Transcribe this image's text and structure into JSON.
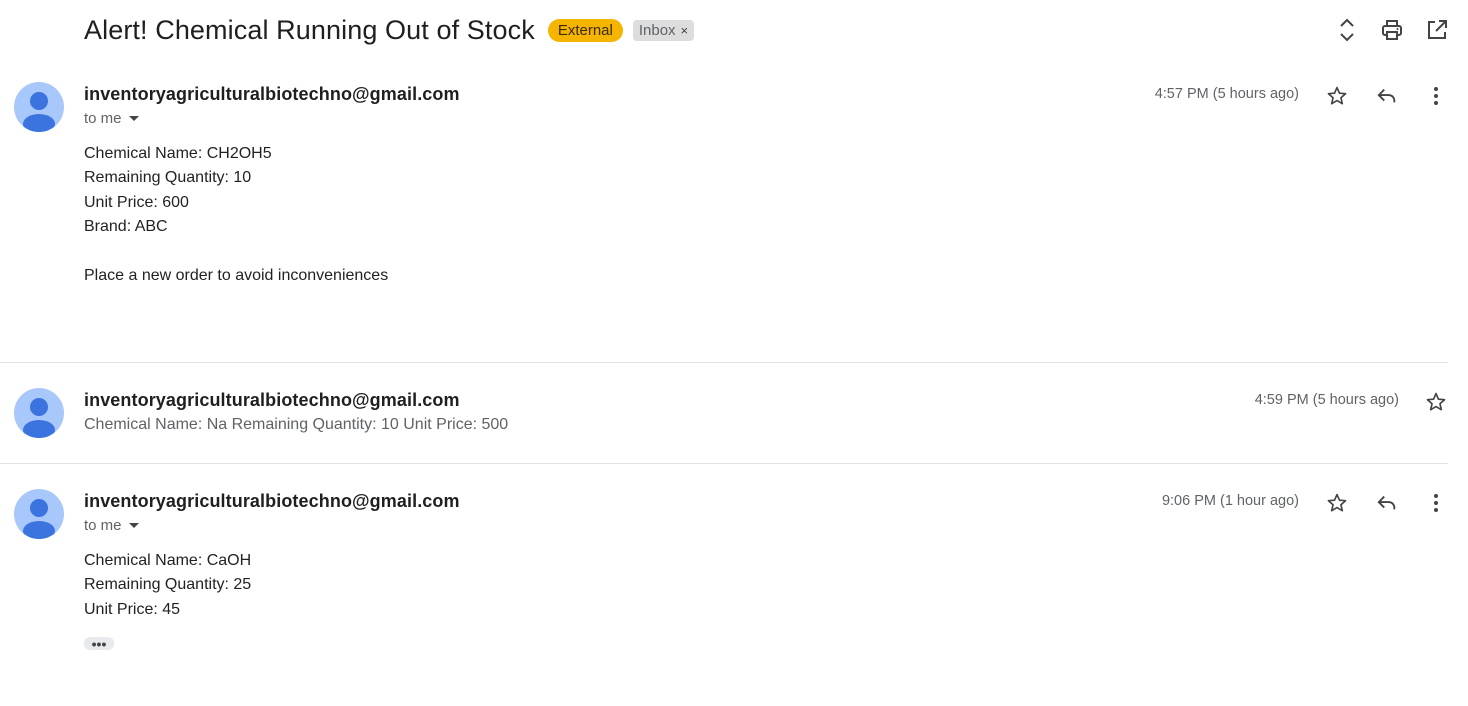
{
  "subject": "Alert! Chemical Running Out of Stock",
  "labels": {
    "external": "External",
    "inbox": "Inbox",
    "remove": "×"
  },
  "header_icons": [
    "expand-collapse-icon",
    "print-icon",
    "open-in-new-window-icon"
  ],
  "messages": [
    {
      "sender": "inventoryagriculturalbiotechno@gmail.com",
      "recipient": "to me",
      "time": "4:57 PM (5 hours ago)",
      "body": [
        "Chemical Name: CH2OH5",
        "Remaining Quantity: 10",
        "Unit Price: 600",
        "Brand: ABC",
        "Place a new order to avoid inconveniences"
      ]
    },
    {
      "sender": "inventoryagriculturalbiotechno@gmail.com",
      "time": "4:59 PM (5 hours ago)",
      "snippet": "Chemical Name: Na Remaining Quantity: 10 Unit Price: 500"
    },
    {
      "sender": "inventoryagriculturalbiotechno@gmail.com",
      "recipient": "to me",
      "time": "9:06 PM (1 hour ago)",
      "body": [
        "Chemical Name: CaOH",
        "Remaining Quantity: 25",
        "Unit Price: 45"
      ],
      "trimmed": "•••"
    }
  ],
  "colors": {
    "external_chip": "#f4b400",
    "avatar_bg": "#a8c7fa",
    "avatar_fg": "#3b74df"
  }
}
